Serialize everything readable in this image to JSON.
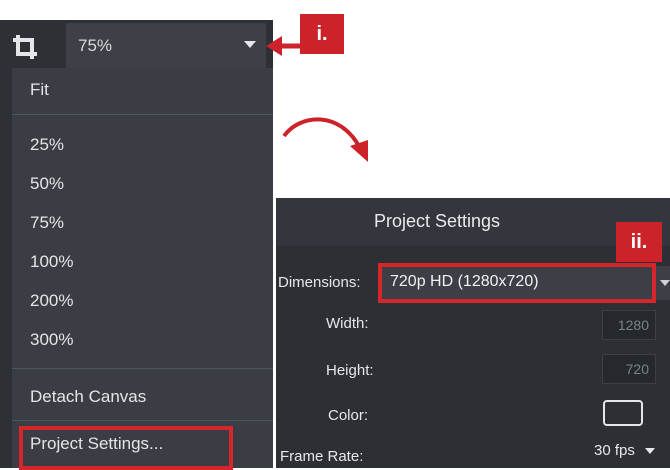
{
  "zoom": {
    "value": "75%",
    "menu_items": [
      "Fit",
      "25%",
      "50%",
      "75%",
      "100%",
      "200%",
      "300%",
      "Detach Canvas",
      "Project Settings..."
    ]
  },
  "callouts": {
    "one": "i.",
    "two": "ii."
  },
  "dialog": {
    "title": "Project Settings",
    "dimensions_label": "Dimensions:",
    "dimensions_value": "720p HD (1280x720)",
    "width_label": "Width:",
    "width_value": "1280",
    "height_label": "Height:",
    "height_value": "720",
    "color_label": "Color:",
    "frame_rate_label": "Frame Rate:",
    "frame_rate_value": "30 fps"
  },
  "colors": {
    "highlight": "#d7262b",
    "panel": "#2d3035",
    "menu": "#3a3e44"
  },
  "icons": {
    "crop": "crop-icon",
    "dropdown": "chevron-down-icon",
    "arrow": "curved-arrow"
  }
}
